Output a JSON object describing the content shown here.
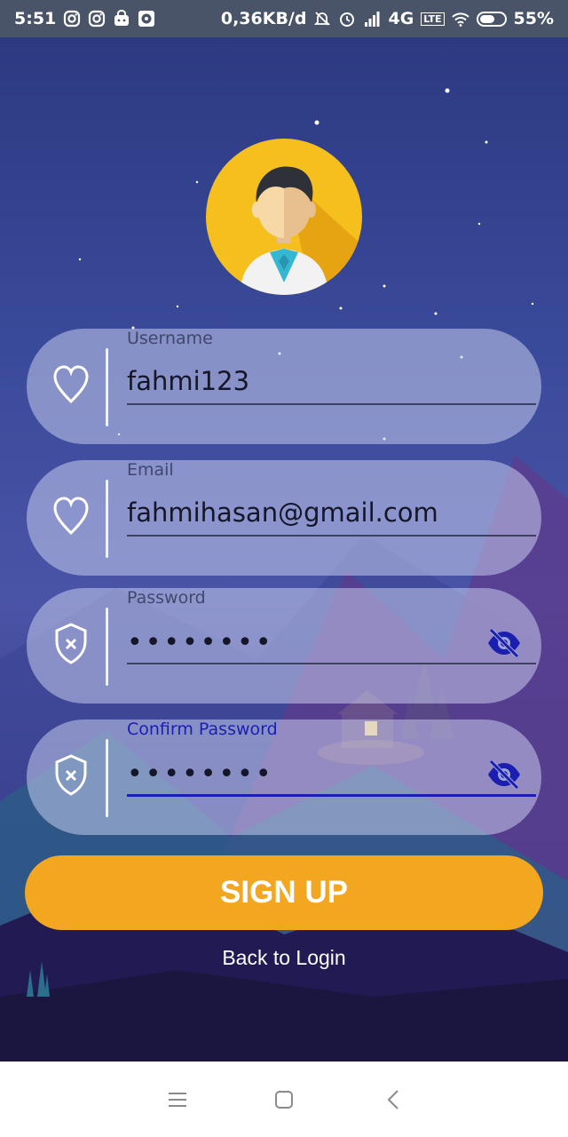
{
  "status_bar": {
    "time": "5:51",
    "network_speed": "0,36KB/d",
    "network_type": "4G",
    "volte": "LTE",
    "battery": "55%",
    "icons": [
      "instagram-icon",
      "instagram-icon",
      "shopping-icon",
      "music-icon",
      "notifications-muted-icon",
      "alarm-icon",
      "signal-icon",
      "wifi-icon",
      "battery-icon"
    ]
  },
  "form": {
    "username": {
      "label": "Username",
      "value": "fahmi123",
      "icon": "heart-icon"
    },
    "email": {
      "label": "Email",
      "value": "fahmihasan@gmail.com",
      "icon": "heart-icon"
    },
    "password": {
      "label": "Password",
      "value": "••••••••",
      "icon": "shield-icon",
      "toggle_icon": "eye-off-icon"
    },
    "confirm_password": {
      "label": "Confirm Password",
      "value": "••••••••",
      "icon": "shield-icon",
      "toggle_icon": "eye-off-icon"
    }
  },
  "actions": {
    "signup_label": "SIGN UP",
    "back_label": "Back to Login"
  },
  "colors": {
    "accent": "#f3a620",
    "focus": "#1b1fb0",
    "status_bar": "#4a5468"
  }
}
